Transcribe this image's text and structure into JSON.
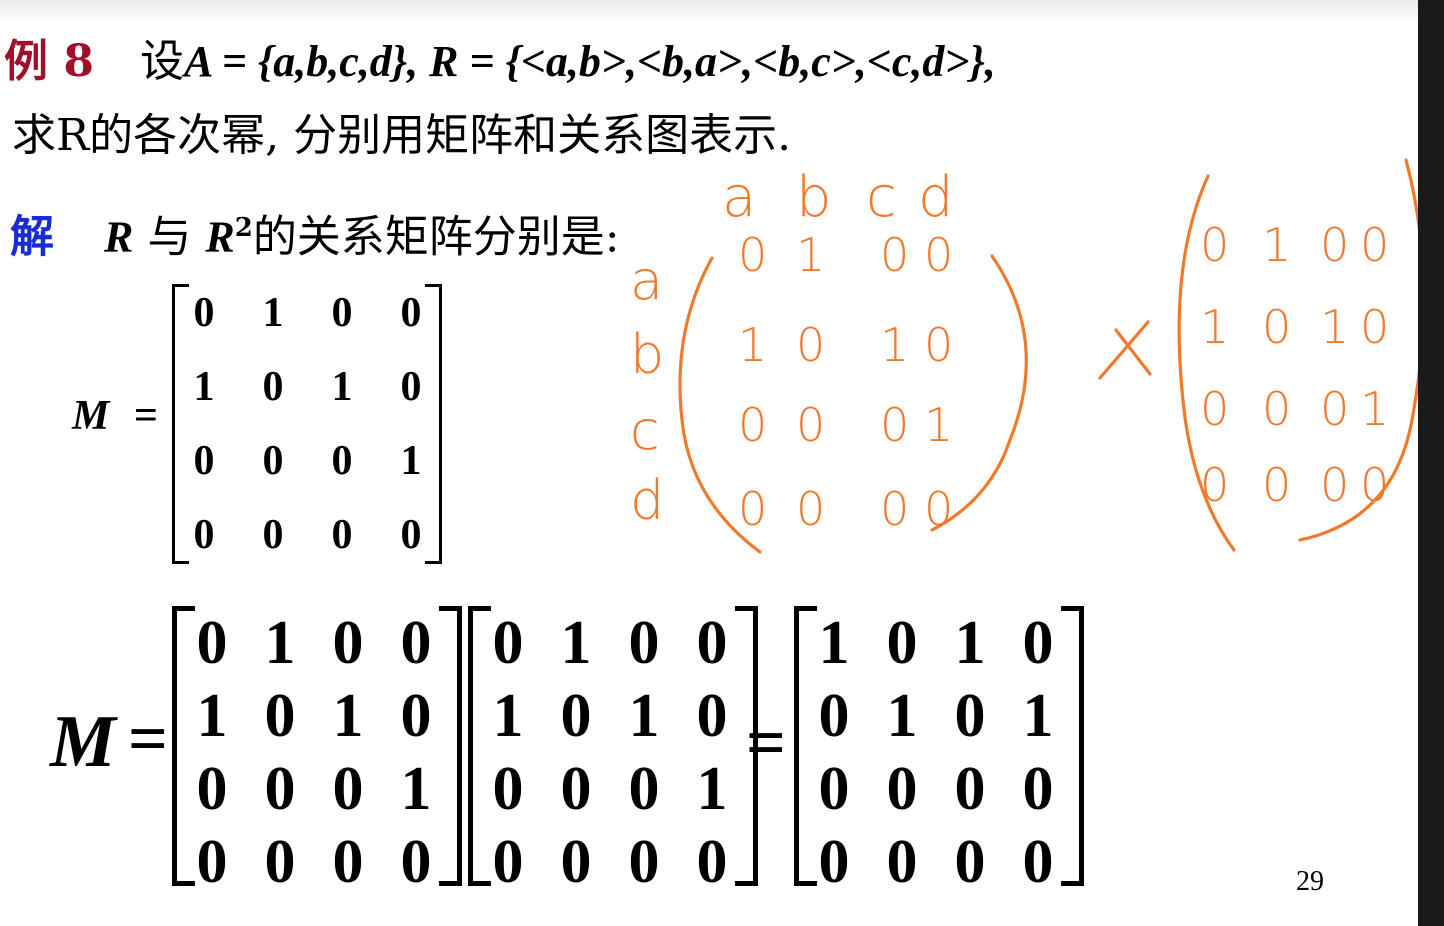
{
  "problem": {
    "label": "例 8",
    "prefix": "设",
    "set_def": "A = {a,b,c,d}, R = {<a,b>,<b,a>,<b,c>,<c,d>},",
    "question": "求R的各次幂, 分别用矩阵和关系图表示."
  },
  "solution": {
    "label": "解",
    "r": "R",
    "with": "与",
    "r2": "R",
    "sup": "2",
    "rest": "的关系矩阵分别是:"
  },
  "matrix_m": {
    "label": "M",
    "eq": "=",
    "rows": [
      [
        "0",
        "1",
        "0",
        "0"
      ],
      [
        "1",
        "0",
        "1",
        "0"
      ],
      [
        "0",
        "0",
        "0",
        "1"
      ],
      [
        "0",
        "0",
        "0",
        "0"
      ]
    ]
  },
  "product": {
    "label": "M",
    "eq1": "=",
    "eq2": "=",
    "left": [
      [
        "0",
        "1",
        "0",
        "0"
      ],
      [
        "1",
        "0",
        "1",
        "0"
      ],
      [
        "0",
        "0",
        "0",
        "1"
      ],
      [
        "0",
        "0",
        "0",
        "0"
      ]
    ],
    "right": [
      [
        "0",
        "1",
        "0",
        "0"
      ],
      [
        "1",
        "0",
        "1",
        "0"
      ],
      [
        "0",
        "0",
        "0",
        "1"
      ],
      [
        "0",
        "0",
        "0",
        "0"
      ]
    ],
    "result": [
      [
        "1",
        "0",
        "1",
        "0"
      ],
      [
        "0",
        "1",
        "0",
        "1"
      ],
      [
        "0",
        "0",
        "0",
        "0"
      ],
      [
        "0",
        "0",
        "0",
        "0"
      ]
    ]
  },
  "annotation": {
    "col_heads": [
      "a",
      "b",
      "c",
      "d"
    ],
    "row_heads": [
      "a",
      "b",
      "c",
      "d"
    ],
    "matrix1": [
      [
        "0",
        "1",
        "0",
        "0"
      ],
      [
        "1",
        "0",
        "1",
        "0"
      ],
      [
        "0",
        "0",
        "0",
        "1"
      ],
      [
        "0",
        "0",
        "0",
        "0"
      ]
    ],
    "times": "×",
    "matrix2": [
      [
        "0",
        "1",
        "0",
        "0"
      ],
      [
        "1",
        "0",
        "1",
        "0"
      ],
      [
        "0",
        "0",
        "0",
        "1"
      ],
      [
        "0",
        "0",
        "0",
        "0"
      ]
    ],
    "color": "#ef7a2c"
  },
  "page_number": "29"
}
